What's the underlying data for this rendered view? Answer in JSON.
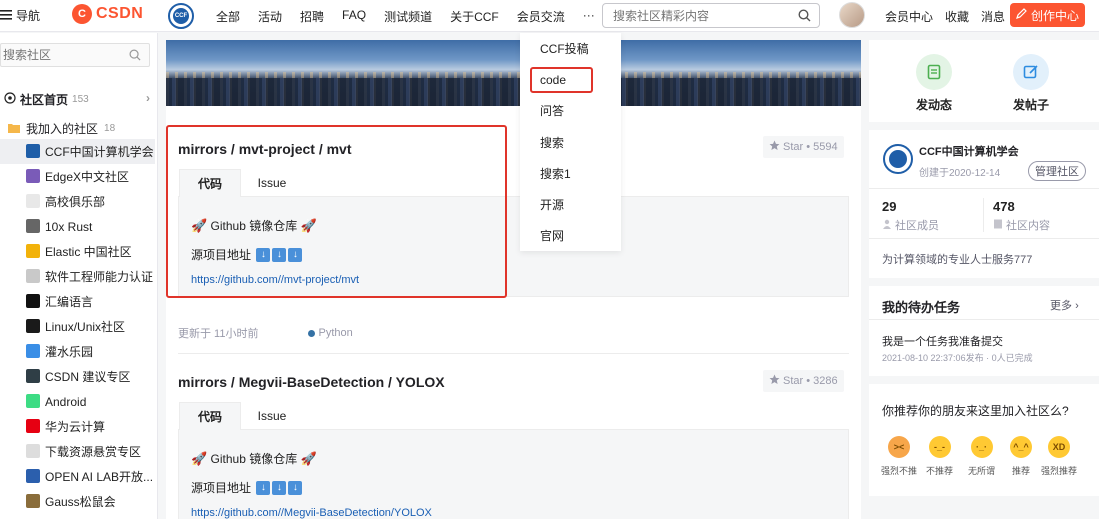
{
  "topbar": {
    "nav_label": "导航",
    "brand": "CSDN",
    "brand_fox": "C",
    "ccf_logo_text": "CCF",
    "menu": [
      "全部",
      "活动",
      "招聘",
      "FAQ",
      "测试频道",
      "关于CCF",
      "会员交流",
      "···"
    ],
    "search_placeholder": "搜索社区精彩内容",
    "links": [
      "会员中心",
      "收藏",
      "消息"
    ],
    "create_label": "创作中心"
  },
  "sidebar": {
    "search_placeholder": "搜索社区",
    "home_label": "社区首页",
    "home_count": "153",
    "joined_label": "我加入的社区",
    "joined_count": "18",
    "items": [
      {
        "label": "CCF中国计算机学会",
        "icon_color": "#1f5ea8",
        "active": true
      },
      {
        "label": "EdgeX中文社区",
        "icon_color": "#7a5bb8"
      },
      {
        "label": "高校俱乐部",
        "icon_color": "#e8e8e8"
      },
      {
        "label": "10x Rust",
        "icon_color": "#666666"
      },
      {
        "label": "Elastic 中国社区",
        "icon_color": "#f2b20a"
      },
      {
        "label": "软件工程师能力认证",
        "icon_color": "#c9c9c9"
      },
      {
        "label": "汇编语言",
        "icon_color": "#111111"
      },
      {
        "label": "Linux/Unix社区",
        "icon_color": "#1a1a1a"
      },
      {
        "label": "灌水乐园",
        "icon_color": "#3a8ee6"
      },
      {
        "label": "CSDN 建议专区",
        "icon_color": "#2f3e46"
      },
      {
        "label": "Android",
        "icon_color": "#3ddc84"
      },
      {
        "label": "华为云计算",
        "icon_color": "#e60012"
      },
      {
        "label": "下载资源悬赏专区",
        "icon_color": "#dddddd"
      },
      {
        "label": "OPEN AI LAB开放...",
        "icon_color": "#2b5fad"
      },
      {
        "label": "Gauss松鼠会",
        "icon_color": "#8a6d3b"
      }
    ]
  },
  "dropdown": {
    "items": [
      "CCF投稿",
      "code",
      "问答",
      "搜索",
      "搜索1",
      "开源",
      "官网"
    ]
  },
  "repos": [
    {
      "title": "mirrors / mvt-project / mvt",
      "star": "Star • 5594",
      "tabs": [
        "代码",
        "Issue"
      ],
      "desc": "Github 镜像仓库",
      "src_label": "源项目地址",
      "link": "https://github.com//mvt-project/mvt",
      "updated": "更新于 11小时前",
      "lang": "Python"
    },
    {
      "title": "mirrors / Megvii-BaseDetection / YOLOX",
      "star": "Star • 3286",
      "tabs": [
        "代码",
        "Issue"
      ],
      "desc": "Github 镜像仓库",
      "src_label": "源项目地址",
      "link": "https://github.com//Megvii-BaseDetection/YOLOX"
    }
  ],
  "right": {
    "actions": [
      {
        "label": "发动态",
        "color": "#4caf50",
        "bg": "#e3f4e5"
      },
      {
        "label": "发帖子",
        "color": "#2d8ce0",
        "bg": "#e2f0fb"
      }
    ],
    "community": {
      "name": "CCF中国计算机学会",
      "created": "创建于2020-12-14",
      "manage": "管理社区",
      "members_num": "29",
      "members_label": "社区成员",
      "content_num": "478",
      "content_label": "社区内容",
      "desc": "为计算领域的专业人士服务777"
    },
    "todo": {
      "title": "我的待办任务",
      "more": "更多",
      "task": "我是一个任务我准备提交",
      "meta": "2021-08-10 22:37:06发布 · 0人已完成"
    },
    "recommend": {
      "title": "你推荐你的朋友来这里加入社区么?",
      "moods": [
        "强烈不推",
        "不推荐",
        "无所谓",
        "推荐",
        "强烈推荐"
      ],
      "faces": [
        "><",
        "-_-",
        "·_·",
        "^_^",
        "XD"
      ]
    }
  },
  "colors": {
    "accent": "#fc5531",
    "highlight": "#e0342a",
    "link": "#1a5fb4"
  }
}
